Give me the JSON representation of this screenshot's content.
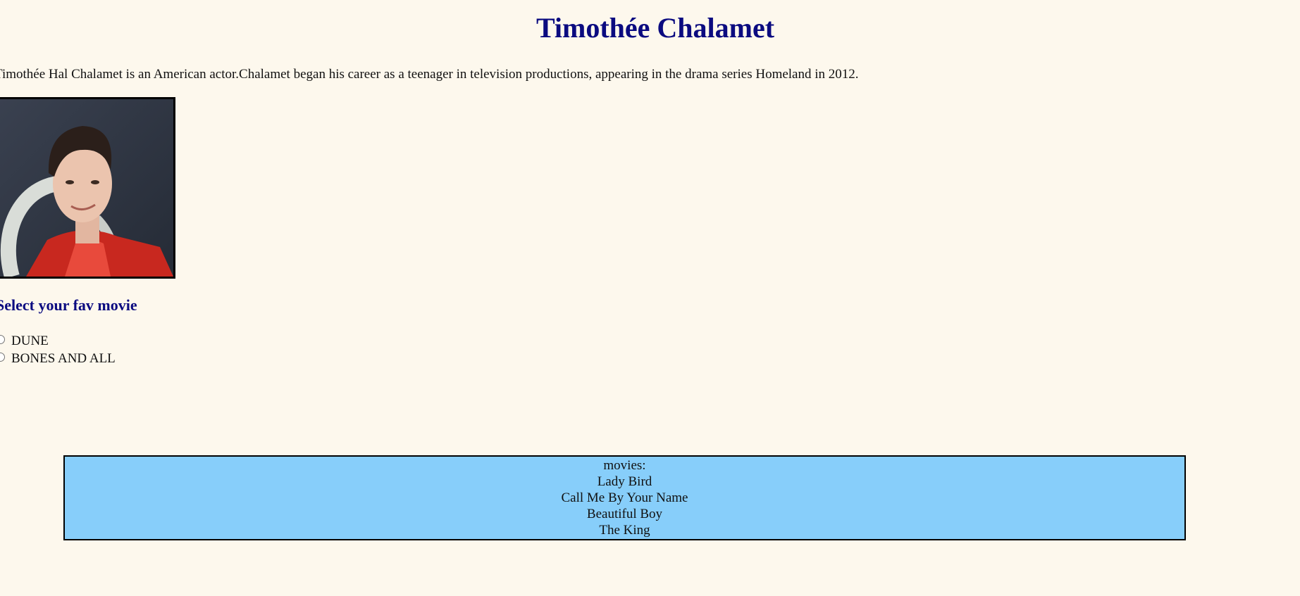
{
  "page": {
    "title": "Timothée Chalamet",
    "intro": "Timothée Hal Chalamet is an American actor.Chalamet began his career as a teenager in television productions, appearing in the drama series Homeland in 2012."
  },
  "poll": {
    "heading": "Select your fav movie",
    "options": [
      {
        "label": "DUNE"
      },
      {
        "label": "BONES AND ALL"
      }
    ]
  },
  "movies": {
    "label": "movies:",
    "items": [
      "Lady Bird",
      "Call Me By Your Name",
      "Beautiful Boy",
      "The King"
    ]
  },
  "colors": {
    "background": "#fdf8ed",
    "heading": "#0b0b80",
    "movies_box": "#87cefa"
  }
}
